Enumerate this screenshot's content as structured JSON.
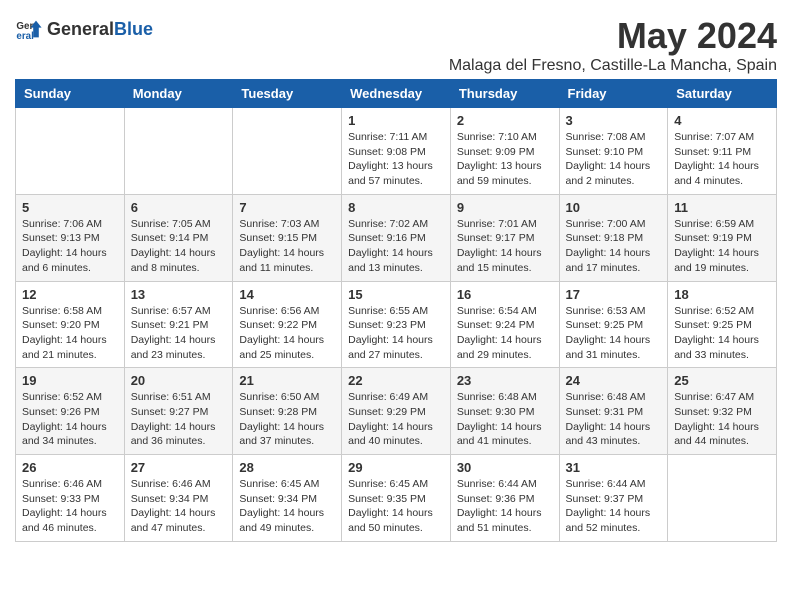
{
  "logo": {
    "text_general": "General",
    "text_blue": "Blue"
  },
  "title": "May 2024",
  "subtitle": "Malaga del Fresno, Castille-La Mancha, Spain",
  "headers": [
    "Sunday",
    "Monday",
    "Tuesday",
    "Wednesday",
    "Thursday",
    "Friday",
    "Saturday"
  ],
  "weeks": [
    [
      {
        "day": "",
        "info": ""
      },
      {
        "day": "",
        "info": ""
      },
      {
        "day": "",
        "info": ""
      },
      {
        "day": "1",
        "info": "Sunrise: 7:11 AM\nSunset: 9:08 PM\nDaylight: 13 hours and 57 minutes."
      },
      {
        "day": "2",
        "info": "Sunrise: 7:10 AM\nSunset: 9:09 PM\nDaylight: 13 hours and 59 minutes."
      },
      {
        "day": "3",
        "info": "Sunrise: 7:08 AM\nSunset: 9:10 PM\nDaylight: 14 hours and 2 minutes."
      },
      {
        "day": "4",
        "info": "Sunrise: 7:07 AM\nSunset: 9:11 PM\nDaylight: 14 hours and 4 minutes."
      }
    ],
    [
      {
        "day": "5",
        "info": "Sunrise: 7:06 AM\nSunset: 9:13 PM\nDaylight: 14 hours and 6 minutes."
      },
      {
        "day": "6",
        "info": "Sunrise: 7:05 AM\nSunset: 9:14 PM\nDaylight: 14 hours and 8 minutes."
      },
      {
        "day": "7",
        "info": "Sunrise: 7:03 AM\nSunset: 9:15 PM\nDaylight: 14 hours and 11 minutes."
      },
      {
        "day": "8",
        "info": "Sunrise: 7:02 AM\nSunset: 9:16 PM\nDaylight: 14 hours and 13 minutes."
      },
      {
        "day": "9",
        "info": "Sunrise: 7:01 AM\nSunset: 9:17 PM\nDaylight: 14 hours and 15 minutes."
      },
      {
        "day": "10",
        "info": "Sunrise: 7:00 AM\nSunset: 9:18 PM\nDaylight: 14 hours and 17 minutes."
      },
      {
        "day": "11",
        "info": "Sunrise: 6:59 AM\nSunset: 9:19 PM\nDaylight: 14 hours and 19 minutes."
      }
    ],
    [
      {
        "day": "12",
        "info": "Sunrise: 6:58 AM\nSunset: 9:20 PM\nDaylight: 14 hours and 21 minutes."
      },
      {
        "day": "13",
        "info": "Sunrise: 6:57 AM\nSunset: 9:21 PM\nDaylight: 14 hours and 23 minutes."
      },
      {
        "day": "14",
        "info": "Sunrise: 6:56 AM\nSunset: 9:22 PM\nDaylight: 14 hours and 25 minutes."
      },
      {
        "day": "15",
        "info": "Sunrise: 6:55 AM\nSunset: 9:23 PM\nDaylight: 14 hours and 27 minutes."
      },
      {
        "day": "16",
        "info": "Sunrise: 6:54 AM\nSunset: 9:24 PM\nDaylight: 14 hours and 29 minutes."
      },
      {
        "day": "17",
        "info": "Sunrise: 6:53 AM\nSunset: 9:25 PM\nDaylight: 14 hours and 31 minutes."
      },
      {
        "day": "18",
        "info": "Sunrise: 6:52 AM\nSunset: 9:25 PM\nDaylight: 14 hours and 33 minutes."
      }
    ],
    [
      {
        "day": "19",
        "info": "Sunrise: 6:52 AM\nSunset: 9:26 PM\nDaylight: 14 hours and 34 minutes."
      },
      {
        "day": "20",
        "info": "Sunrise: 6:51 AM\nSunset: 9:27 PM\nDaylight: 14 hours and 36 minutes."
      },
      {
        "day": "21",
        "info": "Sunrise: 6:50 AM\nSunset: 9:28 PM\nDaylight: 14 hours and 37 minutes."
      },
      {
        "day": "22",
        "info": "Sunrise: 6:49 AM\nSunset: 9:29 PM\nDaylight: 14 hours and 40 minutes."
      },
      {
        "day": "23",
        "info": "Sunrise: 6:48 AM\nSunset: 9:30 PM\nDaylight: 14 hours and 41 minutes."
      },
      {
        "day": "24",
        "info": "Sunrise: 6:48 AM\nSunset: 9:31 PM\nDaylight: 14 hours and 43 minutes."
      },
      {
        "day": "25",
        "info": "Sunrise: 6:47 AM\nSunset: 9:32 PM\nDaylight: 14 hours and 44 minutes."
      }
    ],
    [
      {
        "day": "26",
        "info": "Sunrise: 6:46 AM\nSunset: 9:33 PM\nDaylight: 14 hours and 46 minutes."
      },
      {
        "day": "27",
        "info": "Sunrise: 6:46 AM\nSunset: 9:34 PM\nDaylight: 14 hours and 47 minutes."
      },
      {
        "day": "28",
        "info": "Sunrise: 6:45 AM\nSunset: 9:34 PM\nDaylight: 14 hours and 49 minutes."
      },
      {
        "day": "29",
        "info": "Sunrise: 6:45 AM\nSunset: 9:35 PM\nDaylight: 14 hours and 50 minutes."
      },
      {
        "day": "30",
        "info": "Sunrise: 6:44 AM\nSunset: 9:36 PM\nDaylight: 14 hours and 51 minutes."
      },
      {
        "day": "31",
        "info": "Sunrise: 6:44 AM\nSunset: 9:37 PM\nDaylight: 14 hours and 52 minutes."
      },
      {
        "day": "",
        "info": ""
      }
    ]
  ]
}
